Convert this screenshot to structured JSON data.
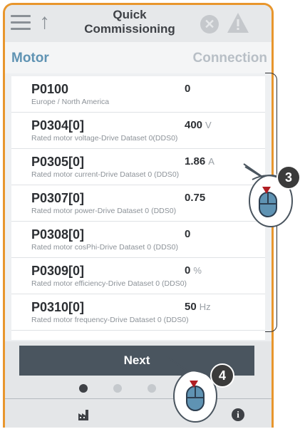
{
  "header": {
    "title_line1": "Quick",
    "title_line2": "Commissioning"
  },
  "tabs": {
    "left": "Motor",
    "right": "Connection"
  },
  "params": [
    {
      "id": "P0100",
      "desc": "Europe / North America",
      "value": "0",
      "unit": ""
    },
    {
      "id": "P0304[0]",
      "desc": "Rated motor voltage-Drive Dataset 0(DDS0)",
      "value": "400",
      "unit": "V"
    },
    {
      "id": "P0305[0]",
      "desc": "Rated motor current-Drive Dataset 0 (DDS0)",
      "value": "1.86",
      "unit": "A"
    },
    {
      "id": "P0307[0]",
      "desc": "Rated motor power-Drive Dataset 0 (DDS0)",
      "value": "0.75",
      "unit": ""
    },
    {
      "id": "P0308[0]",
      "desc": "Rated motor cosPhi-Drive Dataset 0 (DDS0)",
      "value": "0",
      "unit": ""
    },
    {
      "id": "P0309[0]",
      "desc": "Rated motor efficiency-Drive Dataset 0 (DDS0)",
      "value": "0",
      "unit": "%"
    },
    {
      "id": "P0310[0]",
      "desc": "Rated motor frequency-Drive Dataset 0 (DDS0)",
      "value": "50",
      "unit": "Hz"
    }
  ],
  "footer": {
    "next_label": "Next",
    "page_dots": 3,
    "active_dot": 1
  },
  "callouts": {
    "list_scroll": "3",
    "next_click": "4"
  },
  "colors": {
    "accent": "#e8962d",
    "tab_active": "#5f93b3",
    "callout_bg": "#3b3b3b",
    "mouse_blue": "#5f93b3"
  }
}
